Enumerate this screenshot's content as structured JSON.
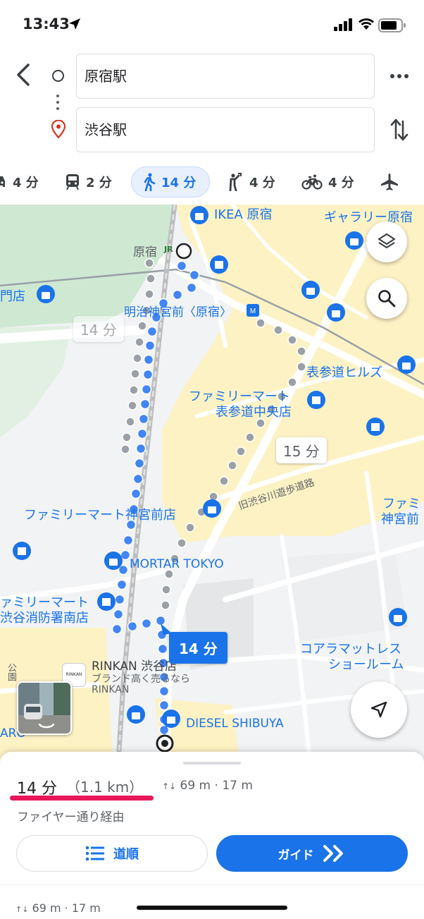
{
  "status_bar": {
    "time": "13:43"
  },
  "route": {
    "origin": "原宿駅",
    "destination": "渋谷駅"
  },
  "modes": [
    {
      "name": "car",
      "label": "4 分",
      "icon": "car-icon"
    },
    {
      "name": "transit",
      "label": "2 分",
      "icon": "train-icon"
    },
    {
      "name": "walk",
      "label": "14 分",
      "icon": "walk-icon",
      "active": true
    },
    {
      "name": "ride",
      "label": "4 分",
      "icon": "ride-hail-icon"
    },
    {
      "name": "bike",
      "label": "4 分",
      "icon": "bicycle-icon"
    },
    {
      "name": "flight",
      "label": "",
      "icon": "airplane-icon"
    }
  ],
  "map": {
    "labels": {
      "ikea": "IKEA 原宿",
      "gallery": "ギャラリー原宿",
      "harajuku": "原宿",
      "jr_mark": "JR",
      "mon_store": "門店",
      "meiji": "明治神宮前〈原宿〉",
      "omotesando_hills": "表参道ヒルズ",
      "fm_omotesando_1": "ファミリーマート",
      "fm_omotesando_2": "表参道中央店",
      "fm_jingumae": "ファミリーマート神宮前店",
      "fm_jingumae_right_1": "ファミ",
      "fm_jingumae_right_2": "神宮前",
      "promenade": "旧渋谷川遊歩道路",
      "mortar": "MORTAR TOKYO",
      "fm_shoubou_1": "ァミリーマート",
      "fm_shoubou_2": "渋谷消防署南店",
      "rinkan": "RINKAN 渋谷店",
      "rinkan_sub1": "ブランド高く売るなら",
      "rinkan_sub2": "RINKAN",
      "rinkan_logo": "RINKAN",
      "coara_1": "コアラマットレス",
      "coara_2": "ショールーム",
      "diesel": "DIESEL SHIBUYA",
      "park": "公園",
      "aro": "ARO"
    },
    "durations": {
      "alt_left": "14 分",
      "alt_right": "15 分",
      "primary": "14 分"
    }
  },
  "sheet": {
    "duration": "14 分",
    "distance": "（1.1 km）",
    "elevation": "69 m · 17 m",
    "via": "ファイヤー通り経由",
    "steps_label": "道順",
    "guide_label": "ガイド",
    "elevation_2": "69 m · 17 m"
  },
  "colors": {
    "accent": "#1a73e8",
    "underline": "#e8185a",
    "route_alt": "#9aa0a6",
    "park": "#c8e6c9",
    "commercial": "#fdf2c4"
  }
}
